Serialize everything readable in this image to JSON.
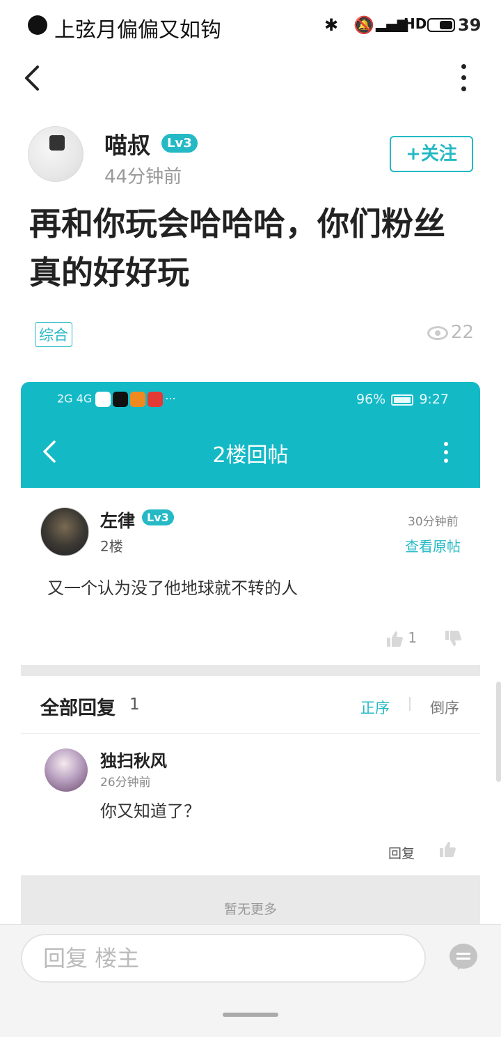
{
  "status_bar": {
    "notification_text": "上弦月偏偏又如钩",
    "battery_level": "39"
  },
  "post": {
    "author": "喵叔",
    "level": "Lv3",
    "time": "44分钟前",
    "follow_label": "+关注",
    "title": "再和你玩会哈哈哈，你们粉丝真的好好玩",
    "tag": "综合",
    "views": "22"
  },
  "screenshot": {
    "status_left": "2G 4G",
    "battery": "96%",
    "clock": "9:27",
    "page_title": "2楼回帖",
    "comment": {
      "author": "左律",
      "level": "Lv3",
      "floor": "2楼",
      "time": "30分钟前",
      "view_original": "查看原帖",
      "content": "又一个认为没了他地球就不转的人",
      "likes": "1"
    },
    "replies_header": "全部回复",
    "replies_count": "1",
    "order_asc": "正序",
    "order_desc": "倒序",
    "reply": {
      "author": "独扫秋风",
      "time": "26分钟前",
      "content": "你又知道了？",
      "reply_label": "回复"
    },
    "no_more": "暂无更多"
  },
  "bottom_bar": {
    "input_placeholder": "回复  楼主"
  },
  "colors": {
    "accent": "#25b9c5",
    "header_teal": "#14b9c6"
  }
}
